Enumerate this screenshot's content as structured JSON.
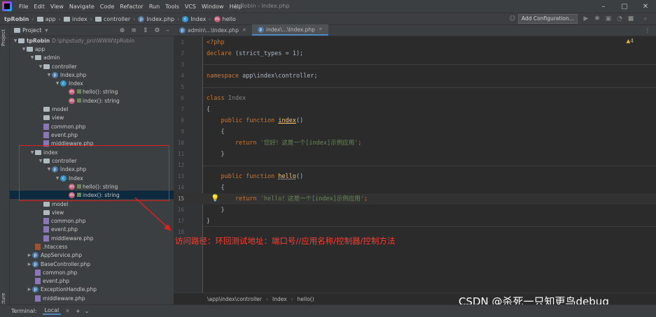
{
  "menubar": {
    "items": [
      "File",
      "Edit",
      "View",
      "Navigate",
      "Code",
      "Refactor",
      "Run",
      "Tools",
      "VCS",
      "Window",
      "Help"
    ],
    "window_title": "tpRobin - Index.php"
  },
  "navbar": {
    "crumbs": [
      "tpRobin",
      "app",
      "index",
      "controller",
      "Index.php",
      "Index",
      "hello"
    ],
    "add_configuration": "Add Configuration..."
  },
  "sidebar": {
    "project_label": "Project",
    "structure_label": "Structure",
    "project_strip_label": "Project",
    "tree": [
      {
        "label": "tpRobin",
        "path": "D:\\phpstudy_pro\\WWW\\tpRobin",
        "icon": "folder-icon"
      },
      {
        "label": "app",
        "icon": "folder-icon"
      },
      {
        "label": "admin",
        "icon": "folder-icon"
      },
      {
        "label": "controller",
        "icon": "folder-icon"
      },
      {
        "label": "Index.php",
        "icon": "php-file-icon"
      },
      {
        "label": "Index",
        "icon": "class-icon"
      },
      {
        "label": "hello(): string",
        "icon": "method-icon"
      },
      {
        "label": "index(): string",
        "icon": "method-icon"
      },
      {
        "label": "model",
        "icon": "folder-icon"
      },
      {
        "label": "view",
        "icon": "folder-icon"
      },
      {
        "label": "common.php",
        "icon": "php-file-icon"
      },
      {
        "label": "event.php",
        "icon": "php-file-icon"
      },
      {
        "label": "middleware.php",
        "icon": "php-file-icon"
      },
      {
        "label": "index",
        "icon": "folder-icon"
      },
      {
        "label": "controller",
        "icon": "folder-icon"
      },
      {
        "label": "Index.php",
        "icon": "php-file-icon"
      },
      {
        "label": "Index",
        "icon": "class-icon"
      },
      {
        "label": "hello(): string",
        "icon": "method-icon"
      },
      {
        "label": "index(): string",
        "icon": "method-icon"
      },
      {
        "label": "model",
        "icon": "folder-icon"
      },
      {
        "label": "view",
        "icon": "folder-icon"
      },
      {
        "label": "common.php",
        "icon": "php-file-icon"
      },
      {
        "label": "event.php",
        "icon": "php-file-icon"
      },
      {
        "label": "middleware.php",
        "icon": "php-file-icon"
      },
      {
        "label": ".htaccess",
        "icon": "htaccess-icon"
      },
      {
        "label": "AppService.php",
        "icon": "php-file-icon"
      },
      {
        "label": "BaseController.php",
        "icon": "php-file-icon"
      },
      {
        "label": "common.php",
        "icon": "php-file-icon"
      },
      {
        "label": "event.php",
        "icon": "php-file-icon"
      },
      {
        "label": "ExceptionHandle.php",
        "icon": "php-file-icon"
      },
      {
        "label": "middleware.php",
        "icon": "php-file-icon"
      }
    ]
  },
  "tabs": [
    {
      "label": "admin\\...\\Index.php",
      "active": false
    },
    {
      "label": "index\\...\\Index.php",
      "active": true
    }
  ],
  "editor": {
    "warning_count": "4",
    "lines": {
      "l1": "<?php",
      "l2_kw": "declare",
      "l2_rest": " (strict_types = 1);",
      "l4_kw": "namespace",
      "l4_rest": " app\\index\\controller;",
      "l6_kw": "class",
      "l6_name": " Index",
      "l7": "{",
      "l8_kw": "public function ",
      "l8_fn": "index",
      "l8_rest": "()",
      "l9": "{",
      "l10_kw": "return ",
      "l10_str": "'您好！这是一个[index]示例应用'",
      "l10_end": ";",
      "l11": "}",
      "l13_kw": "public function ",
      "l13_fn": "hello",
      "l13_rest": "()",
      "l14": "{",
      "l15_kw": "return ",
      "l15_str": "'hello！这是一个[index]示例应用'",
      "l15_end": ";",
      "l16": "}",
      "l17": "}"
    },
    "line_numbers": [
      "1",
      "2",
      "3",
      "4",
      "5",
      "6",
      "7",
      "8",
      "9",
      "10",
      "11",
      "12",
      "13",
      "14",
      "15",
      "16",
      "17",
      "18"
    ]
  },
  "annotation": "访问路径：环回测试地址：端口号//应用名称/控制器/控制方法",
  "status_crumbs": [
    "\\app\\index\\controller",
    "Index",
    "hello()"
  ],
  "bottom": {
    "terminal_label": "Terminal:",
    "local_tab": "Local",
    "add": "+",
    "menu": "⌄"
  },
  "watermark": "CSDN @杀死一只知更鸟debug_",
  "colors": {
    "annotation": "#ff3b2f",
    "keyword": "#cc7832",
    "string": "#6a8759",
    "function": "#ffc66d"
  }
}
